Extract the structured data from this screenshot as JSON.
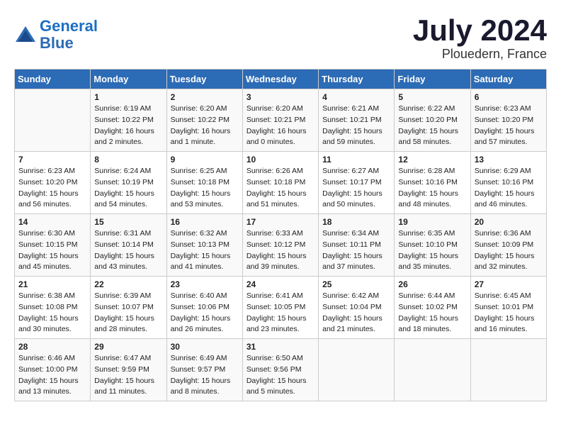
{
  "header": {
    "logo_line1": "General",
    "logo_line2": "Blue",
    "title": "July 2024",
    "subtitle": "Plouedern, France"
  },
  "calendar": {
    "days_of_week": [
      "Sunday",
      "Monday",
      "Tuesday",
      "Wednesday",
      "Thursday",
      "Friday",
      "Saturday"
    ],
    "weeks": [
      [
        {
          "day": "",
          "info": ""
        },
        {
          "day": "1",
          "info": "Sunrise: 6:19 AM\nSunset: 10:22 PM\nDaylight: 16 hours\nand 2 minutes."
        },
        {
          "day": "2",
          "info": "Sunrise: 6:20 AM\nSunset: 10:22 PM\nDaylight: 16 hours\nand 1 minute."
        },
        {
          "day": "3",
          "info": "Sunrise: 6:20 AM\nSunset: 10:21 PM\nDaylight: 16 hours\nand 0 minutes."
        },
        {
          "day": "4",
          "info": "Sunrise: 6:21 AM\nSunset: 10:21 PM\nDaylight: 15 hours\nand 59 minutes."
        },
        {
          "day": "5",
          "info": "Sunrise: 6:22 AM\nSunset: 10:20 PM\nDaylight: 15 hours\nand 58 minutes."
        },
        {
          "day": "6",
          "info": "Sunrise: 6:23 AM\nSunset: 10:20 PM\nDaylight: 15 hours\nand 57 minutes."
        }
      ],
      [
        {
          "day": "7",
          "info": "Sunrise: 6:23 AM\nSunset: 10:20 PM\nDaylight: 15 hours\nand 56 minutes."
        },
        {
          "day": "8",
          "info": "Sunrise: 6:24 AM\nSunset: 10:19 PM\nDaylight: 15 hours\nand 54 minutes."
        },
        {
          "day": "9",
          "info": "Sunrise: 6:25 AM\nSunset: 10:18 PM\nDaylight: 15 hours\nand 53 minutes."
        },
        {
          "day": "10",
          "info": "Sunrise: 6:26 AM\nSunset: 10:18 PM\nDaylight: 15 hours\nand 51 minutes."
        },
        {
          "day": "11",
          "info": "Sunrise: 6:27 AM\nSunset: 10:17 PM\nDaylight: 15 hours\nand 50 minutes."
        },
        {
          "day": "12",
          "info": "Sunrise: 6:28 AM\nSunset: 10:16 PM\nDaylight: 15 hours\nand 48 minutes."
        },
        {
          "day": "13",
          "info": "Sunrise: 6:29 AM\nSunset: 10:16 PM\nDaylight: 15 hours\nand 46 minutes."
        }
      ],
      [
        {
          "day": "14",
          "info": "Sunrise: 6:30 AM\nSunset: 10:15 PM\nDaylight: 15 hours\nand 45 minutes."
        },
        {
          "day": "15",
          "info": "Sunrise: 6:31 AM\nSunset: 10:14 PM\nDaylight: 15 hours\nand 43 minutes."
        },
        {
          "day": "16",
          "info": "Sunrise: 6:32 AM\nSunset: 10:13 PM\nDaylight: 15 hours\nand 41 minutes."
        },
        {
          "day": "17",
          "info": "Sunrise: 6:33 AM\nSunset: 10:12 PM\nDaylight: 15 hours\nand 39 minutes."
        },
        {
          "day": "18",
          "info": "Sunrise: 6:34 AM\nSunset: 10:11 PM\nDaylight: 15 hours\nand 37 minutes."
        },
        {
          "day": "19",
          "info": "Sunrise: 6:35 AM\nSunset: 10:10 PM\nDaylight: 15 hours\nand 35 minutes."
        },
        {
          "day": "20",
          "info": "Sunrise: 6:36 AM\nSunset: 10:09 PM\nDaylight: 15 hours\nand 32 minutes."
        }
      ],
      [
        {
          "day": "21",
          "info": "Sunrise: 6:38 AM\nSunset: 10:08 PM\nDaylight: 15 hours\nand 30 minutes."
        },
        {
          "day": "22",
          "info": "Sunrise: 6:39 AM\nSunset: 10:07 PM\nDaylight: 15 hours\nand 28 minutes."
        },
        {
          "day": "23",
          "info": "Sunrise: 6:40 AM\nSunset: 10:06 PM\nDaylight: 15 hours\nand 26 minutes."
        },
        {
          "day": "24",
          "info": "Sunrise: 6:41 AM\nSunset: 10:05 PM\nDaylight: 15 hours\nand 23 minutes."
        },
        {
          "day": "25",
          "info": "Sunrise: 6:42 AM\nSunset: 10:04 PM\nDaylight: 15 hours\nand 21 minutes."
        },
        {
          "day": "26",
          "info": "Sunrise: 6:44 AM\nSunset: 10:02 PM\nDaylight: 15 hours\nand 18 minutes."
        },
        {
          "day": "27",
          "info": "Sunrise: 6:45 AM\nSunset: 10:01 PM\nDaylight: 15 hours\nand 16 minutes."
        }
      ],
      [
        {
          "day": "28",
          "info": "Sunrise: 6:46 AM\nSunset: 10:00 PM\nDaylight: 15 hours\nand 13 minutes."
        },
        {
          "day": "29",
          "info": "Sunrise: 6:47 AM\nSunset: 9:59 PM\nDaylight: 15 hours\nand 11 minutes."
        },
        {
          "day": "30",
          "info": "Sunrise: 6:49 AM\nSunset: 9:57 PM\nDaylight: 15 hours\nand 8 minutes."
        },
        {
          "day": "31",
          "info": "Sunrise: 6:50 AM\nSunset: 9:56 PM\nDaylight: 15 hours\nand 5 minutes."
        },
        {
          "day": "",
          "info": ""
        },
        {
          "day": "",
          "info": ""
        },
        {
          "day": "",
          "info": ""
        }
      ]
    ]
  }
}
